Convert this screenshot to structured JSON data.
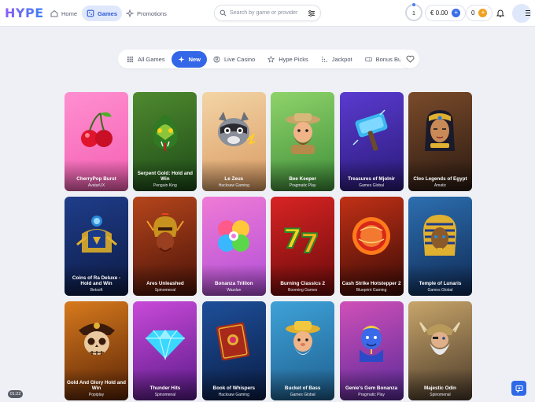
{
  "brand": {
    "logo_text": "HYPE"
  },
  "nav": {
    "home": "Home",
    "games": "Games",
    "promotions": "Promotions"
  },
  "search": {
    "placeholder": "Search by game or provider"
  },
  "account": {
    "level": "1",
    "balance": "€ 0.00",
    "coins": "0"
  },
  "categories": [
    {
      "label": "All Games",
      "icon": "grid-icon"
    },
    {
      "label": "New",
      "icon": "sparkle-icon",
      "active": true
    },
    {
      "label": "Live Casino",
      "icon": "user-circle-icon"
    },
    {
      "label": "Hype Picks",
      "icon": "star-icon"
    },
    {
      "label": "Jackpot",
      "icon": "dots-grid-icon"
    },
    {
      "label": "Bonus Buy",
      "icon": "ticket-icon"
    }
  ],
  "games": [
    {
      "title": "CherryPop Burst",
      "provider": "AvatarUX",
      "bg1": "#ff8fd0",
      "bg2": "#f45fb2",
      "art": "cherry"
    },
    {
      "title": "Serpent Gold: Hold and Win",
      "provider": "Penguin King",
      "bg1": "#4f8a2f",
      "bg2": "#1d4a18",
      "art": "snake"
    },
    {
      "title": "Le Zeus",
      "provider": "Hacksaw Gaming",
      "bg1": "#f3d5a6",
      "bg2": "#d99a62",
      "art": "raccoon"
    },
    {
      "title": "Bee Keeper",
      "provider": "Pragmatic Play",
      "bg1": "#8fd36a",
      "bg2": "#3f8f3a",
      "art": "keeper"
    },
    {
      "title": "Treasures of Mjolnir",
      "provider": "Games Global",
      "bg1": "#5a3bd0",
      "bg2": "#2a1a78",
      "art": "hammer"
    },
    {
      "title": "Cleo Legends of Egypt",
      "provider": "Amatic",
      "bg1": "#7a4b2a",
      "bg2": "#2b1a12",
      "art": "cleo"
    },
    {
      "title": "Coins of Ra Deluxe - Hold and Win",
      "provider": "Betsoft",
      "bg1": "#1f3d8a",
      "bg2": "#0d1b45",
      "art": "ra"
    },
    {
      "title": "Ares Unleashed",
      "provider": "Spinomenal",
      "bg1": "#b5461c",
      "bg2": "#4a1208",
      "art": "ares"
    },
    {
      "title": "Bonanza Trillion",
      "provider": "Wazdan",
      "bg1": "#f07bd6",
      "bg2": "#b04fd8",
      "art": "clover"
    },
    {
      "title": "Burning Classics 2",
      "provider": "Booming Games",
      "bg1": "#d92424",
      "bg2": "#6a0a0a",
      "art": "sevens"
    },
    {
      "title": "Cash Strike Hotstepper 2",
      "provider": "Blueprint Gaming",
      "bg1": "#c23116",
      "bg2": "#3a0a06",
      "art": "orb"
    },
    {
      "title": "Temple of Lunaris",
      "provider": "Games Global",
      "bg1": "#2d6fb0",
      "bg2": "#0f2a55",
      "art": "pharaoh"
    },
    {
      "title": "Gold And Glory Hold and Win",
      "provider": "Popiplay",
      "bg1": "#d77a1d",
      "bg2": "#5a2406",
      "art": "skull"
    },
    {
      "title": "Thunder Hits",
      "provider": "Spinomenal",
      "bg1": "#c94ad8",
      "bg2": "#5a1a8a",
      "art": "diamond"
    },
    {
      "title": "Book of Whispers",
      "provider": "Hacksaw Gaming",
      "bg1": "#1e4f9a",
      "bg2": "#0a1d45",
      "art": "book"
    },
    {
      "title": "Bucket of Bass",
      "provider": "Games Global",
      "bg1": "#3ea2d8",
      "bg2": "#1f5f8f",
      "art": "fisher"
    },
    {
      "title": "Genie's Gem Bonanza",
      "provider": "Pragmatic Play",
      "bg1": "#d050b8",
      "bg2": "#5a2a9a",
      "art": "genie"
    },
    {
      "title": "Majestic Odin",
      "provider": "Spinomenal",
      "bg1": "#c8a56a",
      "bg2": "#4a3a2a",
      "art": "odin"
    }
  ],
  "timer": {
    "text": "01:22"
  }
}
